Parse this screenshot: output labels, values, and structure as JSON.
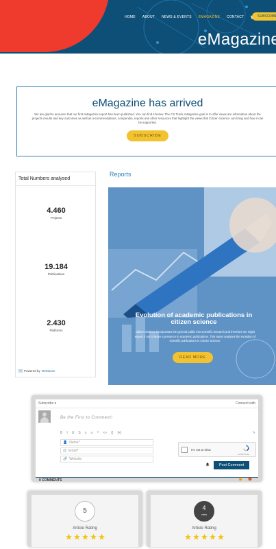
{
  "colors": {
    "brand_blue": "#0e4f78",
    "accent_yellow": "#f2c231",
    "accent_red": "#ef3b2d",
    "link_blue": "#2d7fb8"
  },
  "header": {
    "nav": [
      "HOME",
      "ABOUT",
      "NEWS & EVENTS",
      "EMAGAZINE",
      "CONTACT"
    ],
    "active_nav": "EMAGAZINE",
    "subscribe": "SUBSCRIBE",
    "title": "eMagazine"
  },
  "announcement": {
    "title": "eMagazine has arrived",
    "text": "We are glad to anounce that our first eMagazine report has been published. You can find it below. The CS Track eMagazine goal is to offer views are information about the projects results and key outcomes as well as recommendations, compendia, reports and other resources that highlight the views that Citizen Science can bring and how it can be supported.",
    "button": "SUBSCRIBE"
  },
  "stats": {
    "title": "Total Numbers analysed",
    "items": [
      {
        "value": "4.460",
        "label": "Projects"
      },
      {
        "value": "19.184",
        "label": "Publications"
      },
      {
        "value": "2.430",
        "label": "Platforms"
      }
    ],
    "powered_by": "Powered by",
    "powered_link": "Metabase"
  },
  "reports": {
    "heading": "Reports",
    "card": {
      "title": "Evolution of academic publications in citizen science",
      "text": "Citizen Science incorporates the general public into scientific research and therefore we might expect it not to leave a presence in academic publications. This report analyses the evolution of scientific publications in Citizen Science.",
      "button": "READ MORE"
    }
  },
  "comments": {
    "subscribe": "Subscribe ▾",
    "connect": "Connect with",
    "placeholder": "Be the First to Comment!",
    "toolbar": [
      "B",
      "I",
      "U",
      "S",
      "≡",
      "≡",
      "❝",
      "<>",
      "{}",
      "[+]"
    ],
    "toolbar_end": "✎",
    "name_ph": "Name*",
    "email_ph": "Email*",
    "website_ph": "Website",
    "captcha_text": "I'm not a robot",
    "captcha_brand": "reCAPTCHA",
    "post": "Post Comment",
    "count": "0 COMMENTS"
  },
  "ratings": [
    {
      "value": "5",
      "votes": "",
      "label": "Article Rating",
      "stars": 5
    },
    {
      "value": "4",
      "votes": "votes",
      "label": "Article Rating",
      "stars": 5
    }
  ]
}
